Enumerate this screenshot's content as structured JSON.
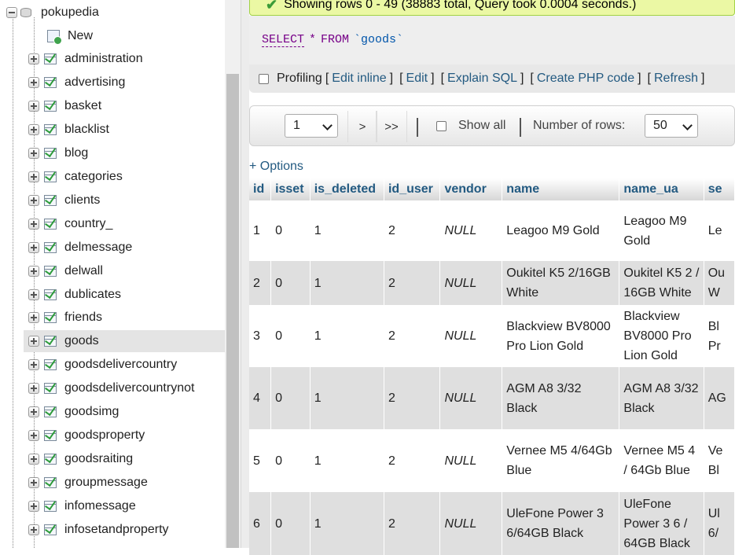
{
  "navigation": {
    "database": "pokupedia",
    "new_label": "New",
    "selected_table": "goods",
    "tables": [
      "administration",
      "advertising",
      "basket",
      "blacklist",
      "blog",
      "categories",
      "clients",
      "country_",
      "delmessage",
      "delwall",
      "dublicates",
      "friends",
      "goods",
      "goodsdelivercountry",
      "goodsdelivercountrynot",
      "goodsimg",
      "goodsproperty",
      "goodsraiting",
      "groupmessage",
      "infomessage",
      "infosetandproperty"
    ]
  },
  "message": {
    "text": "Showing rows 0 - 49 (38883 total, Query took 0.0004 seconds.)",
    "icon": "check-icon"
  },
  "query": {
    "select": "SELECT",
    "star": "*",
    "from": "FROM",
    "table": "`goods`"
  },
  "query_links": {
    "profiling": "Profiling",
    "edit_inline": "Edit inline",
    "edit": "Edit",
    "explain_sql": "Explain SQL",
    "create_php": "Create PHP code",
    "refresh": "Refresh"
  },
  "pager": {
    "page": "1",
    "next": ">",
    "last": ">>",
    "show_all": "Show all",
    "rows_label": "Number of rows:",
    "rows_value": "50"
  },
  "options_label": "+ Options",
  "table": {
    "columns": [
      "id",
      "isset",
      "is_deleted",
      "id_user",
      "vendor",
      "name",
      "name_ua",
      "se"
    ],
    "rows": [
      {
        "id": "1",
        "isset": "0",
        "is_deleted": "1",
        "id_user": "2",
        "vendor": "NULL",
        "name": "Leagoo M9 Gold",
        "name_ua": "Leagoo M9 Gold",
        "se": "Le"
      },
      {
        "id": "2",
        "isset": "0",
        "is_deleted": "1",
        "id_user": "2",
        "vendor": "NULL",
        "name": "Oukitel K5 2/16GB White",
        "name_ua": "Oukitel K5 2 / 16GB White",
        "se": "Ou W"
      },
      {
        "id": "3",
        "isset": "0",
        "is_deleted": "1",
        "id_user": "2",
        "vendor": "NULL",
        "name": "Blackview BV8000 Pro Lion Gold",
        "name_ua": "Blackview BV8000 Pro Lion Gold",
        "se": "Bl Pr"
      },
      {
        "id": "4",
        "isset": "0",
        "is_deleted": "1",
        "id_user": "2",
        "vendor": "NULL",
        "name": "AGM A8 3/32 Black",
        "name_ua": "AGM A8 3/32 Black",
        "se": "AG"
      },
      {
        "id": "5",
        "isset": "0",
        "is_deleted": "1",
        "id_user": "2",
        "vendor": "NULL",
        "name": "Vernee M5 4/64Gb Blue",
        "name_ua": "Vernee M5 4 / 64Gb Blue",
        "se": "Ve Bl"
      },
      {
        "id": "6",
        "isset": "0",
        "is_deleted": "1",
        "id_user": "2",
        "vendor": "NULL",
        "name": "UleFone Power 3 6/64GB Black",
        "name_ua": "UleFone Power 3 6 / 64GB Black",
        "se": "Ul 6/"
      }
    ]
  }
}
